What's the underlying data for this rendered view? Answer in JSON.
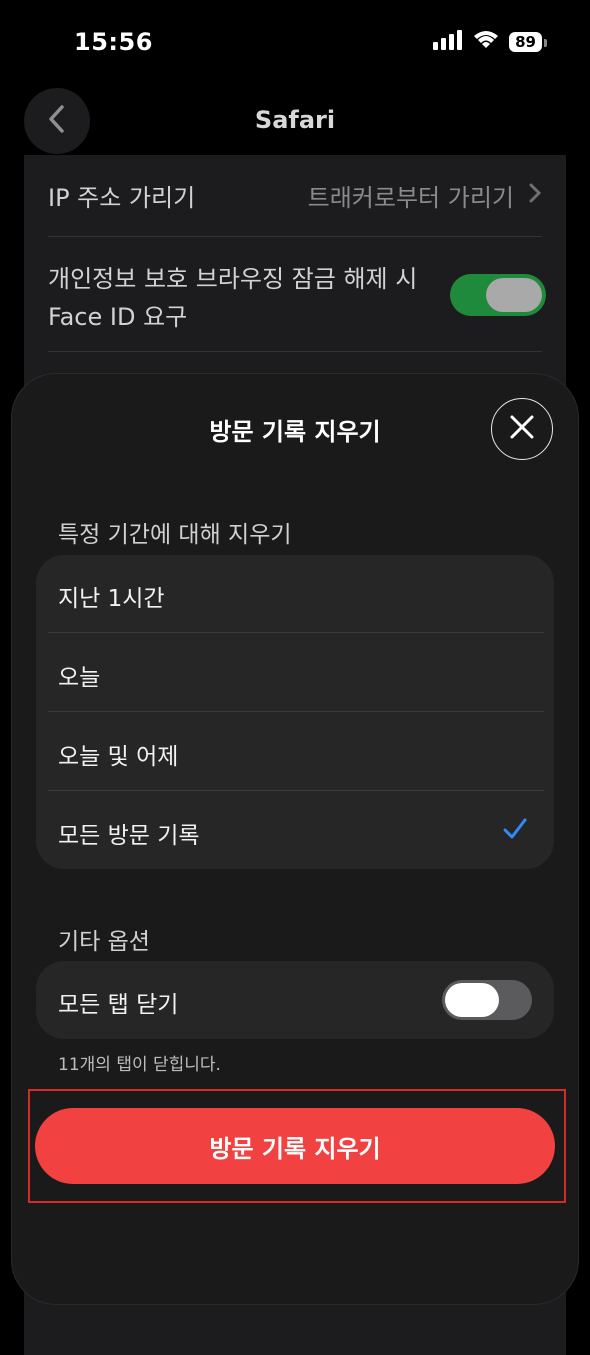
{
  "status_bar": {
    "time": "15:56",
    "battery": "89"
  },
  "nav": {
    "title": "Safari"
  },
  "background_settings": {
    "ip_hide_label": "IP 주소 가리기",
    "ip_hide_value": "트래커로부터 가리기",
    "private_lock_line1": "개인정보 보호 브라우징 잠금 해제 시",
    "private_lock_line2": "Face ID 요구",
    "private_lock_on": true
  },
  "sheet": {
    "title": "방문 기록 지우기",
    "timeframe_header": "특정 기간에 대해 지우기",
    "timeframes": [
      {
        "label": "지난 1시간",
        "selected": false
      },
      {
        "label": "오늘",
        "selected": false
      },
      {
        "label": "오늘 및 어제",
        "selected": false
      },
      {
        "label": "모든 방문 기록",
        "selected": true
      }
    ],
    "other_options_header": "기타 옵션",
    "close_all_tabs_label": "모든 탭 닫기",
    "close_all_tabs_on": false,
    "footnote": "11개의 탭이 닫힙니다.",
    "clear_button": "방문 기록 지우기"
  },
  "colors": {
    "accent_check": "#2f8cf6",
    "destructive": "#f24141",
    "toggle_on": "#1f8a3b",
    "highlight_border": "#d42a2a"
  }
}
